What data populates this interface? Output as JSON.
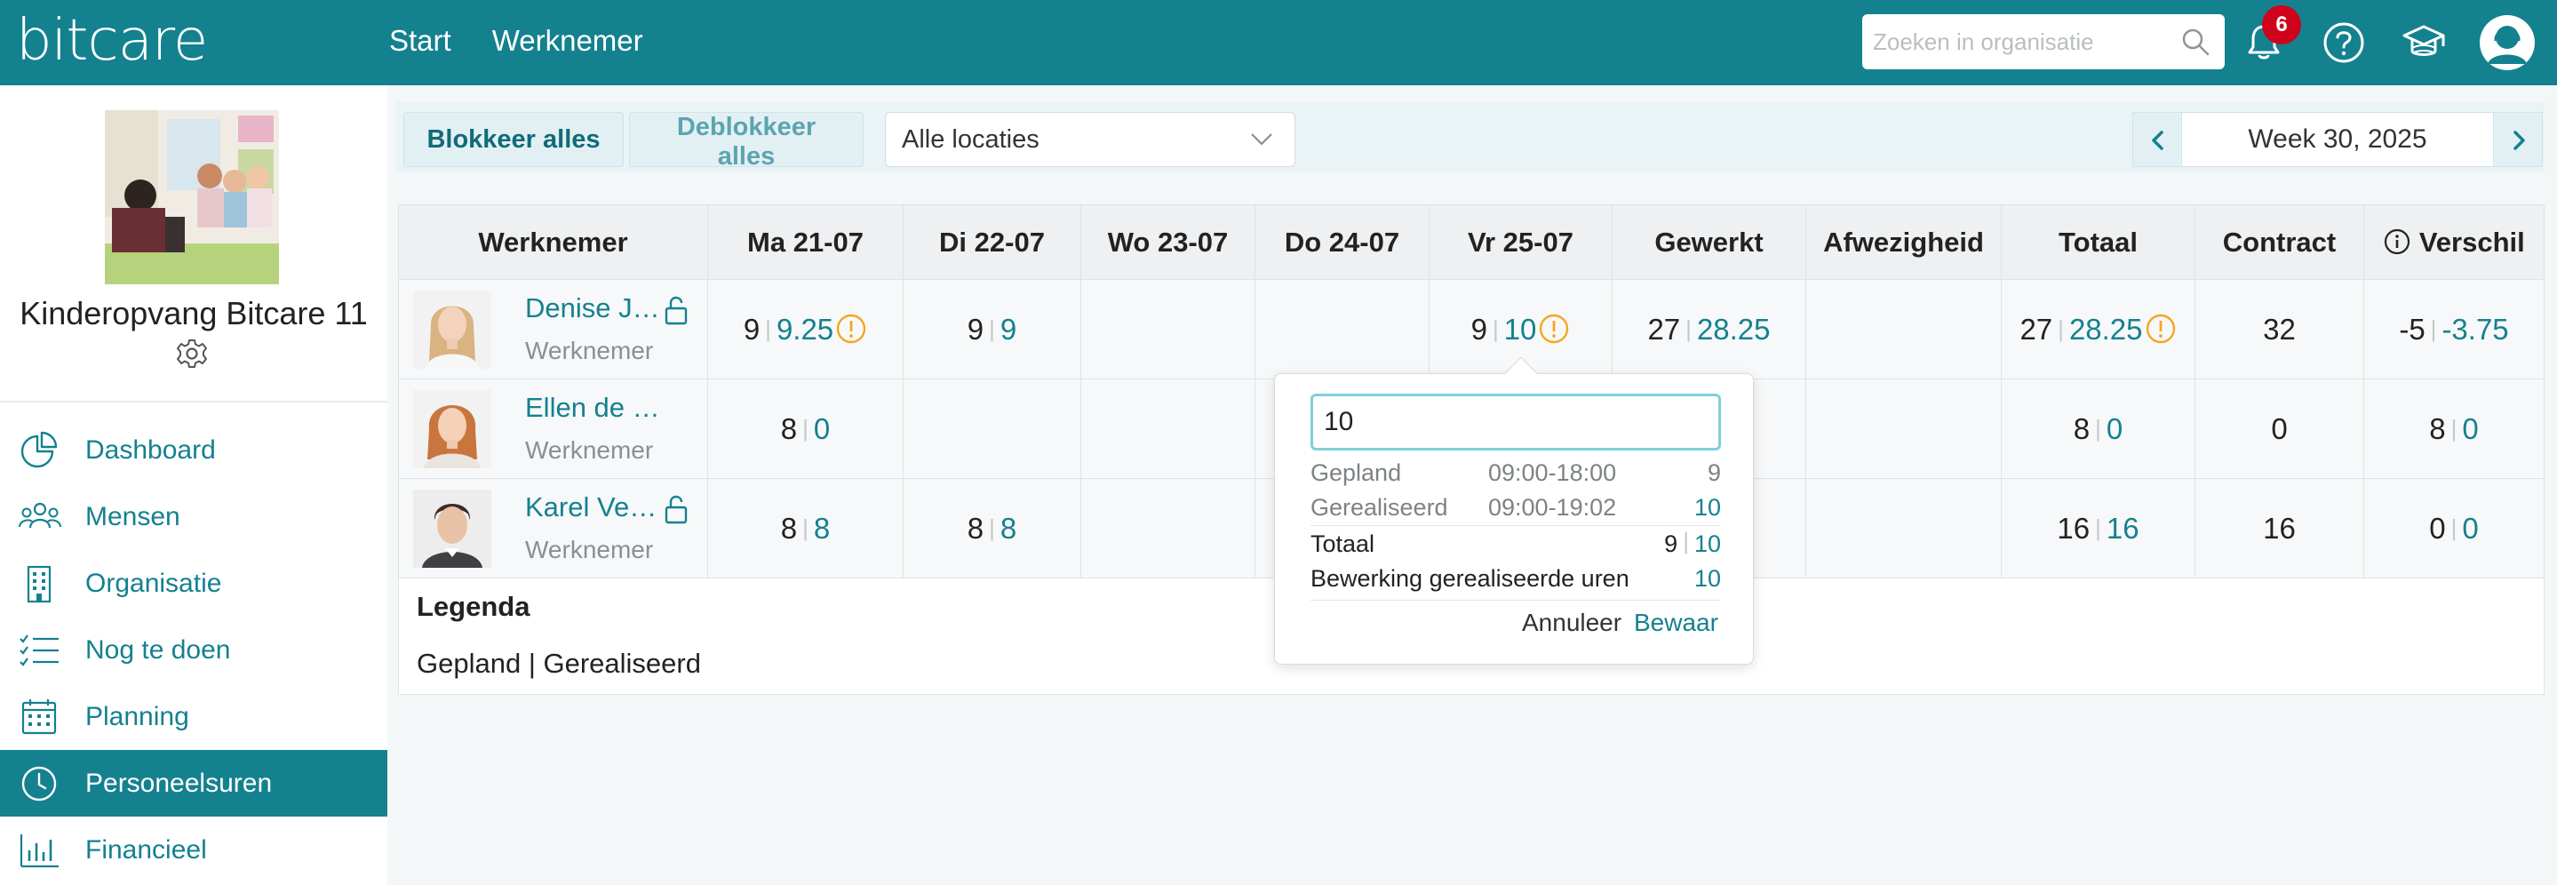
{
  "topbar": {
    "logo": "bitcare",
    "nav": [
      "Start",
      "Werknemer"
    ],
    "search_placeholder": "Zoeken in organisatie",
    "notification_count": "6",
    "accent": "#14818f",
    "badge_color": "#d0021b",
    "icons": [
      "search-icon",
      "bell-icon",
      "help-icon",
      "graduation-cap-icon",
      "user-avatar-icon"
    ]
  },
  "sidebar": {
    "org_name": "Kinderopvang Bitcare 11",
    "menu": [
      {
        "label": "Dashboard",
        "icon": "pie-chart-icon",
        "active": false
      },
      {
        "label": "Mensen",
        "icon": "people-icon",
        "active": false
      },
      {
        "label": "Organisatie",
        "icon": "building-icon",
        "active": false
      },
      {
        "label": "Nog te doen",
        "icon": "checklist-icon",
        "active": false
      },
      {
        "label": "Planning",
        "icon": "calendar-icon",
        "active": false
      },
      {
        "label": "Personeelsuren",
        "icon": "clock-icon",
        "active": true
      },
      {
        "label": "Financieel",
        "icon": "bar-chart-icon",
        "active": false
      }
    ]
  },
  "toolbar": {
    "block_all": "Blokkeer alles",
    "unblock_all": "Deblokkeer alles",
    "location": "Alle locaties",
    "week": "Week 30, 2025"
  },
  "table": {
    "headers": [
      "Werknemer",
      "Ma 21-07",
      "Di 22-07",
      "Wo 23-07",
      "Do 24-07",
      "Vr 25-07",
      "Gewerkt",
      "Afwezigheid",
      "Totaal",
      "Contract",
      "Verschil"
    ],
    "rows": [
      {
        "name": "Denise J…",
        "role": "Werknemer",
        "locked": true,
        "days": [
          {
            "p": "9",
            "r": "9.25",
            "warn": true
          },
          {
            "p": "9",
            "r": "9",
            "warn": false
          },
          null,
          null,
          {
            "p": "9",
            "r": "10",
            "warn": true
          }
        ],
        "gewerkt": {
          "p": "27",
          "r": "28.25",
          "warn": false
        },
        "totaal": {
          "p": "27",
          "r": "28.25",
          "warn": true
        },
        "contract": "32",
        "verschil": {
          "p": "-5",
          "r": "-3.75",
          "warn": false
        }
      },
      {
        "name": "Ellen de …",
        "role": "Werknemer",
        "locked": false,
        "days": [
          {
            "p": "8",
            "r": "0",
            "warn": false
          },
          null,
          null,
          null,
          null
        ],
        "gewerkt": null,
        "totaal": {
          "p": "8",
          "r": "0",
          "warn": false
        },
        "contract": "0",
        "verschil": {
          "p": "8",
          "r": "0",
          "warn": false
        }
      },
      {
        "name": "Karel Ve…",
        "role": "Werknemer",
        "locked": true,
        "days": [
          {
            "p": "8",
            "r": "8",
            "warn": false
          },
          {
            "p": "8",
            "r": "8",
            "warn": false
          },
          null,
          null,
          null
        ],
        "gewerkt": null,
        "totaal": {
          "p": "16",
          "r": "16",
          "warn": false
        },
        "contract": "16",
        "verschil": {
          "p": "0",
          "r": "0",
          "warn": false
        }
      }
    ]
  },
  "legend": {
    "title": "Legenda",
    "text": "Gepland | Gerealiseerd"
  },
  "popover": {
    "input_value": "10",
    "gepland_label": "Gepland",
    "gepland_time": "09:00-18:00",
    "gepland_value": "9",
    "gerealiseerd_label": "Gerealiseerd",
    "gerealiseerd_time": "09:00-19:02",
    "gerealiseerd_value": "10",
    "totaal_label": "Totaal",
    "totaal_p": "9",
    "totaal_r": "10",
    "bewerking_label": "Bewerking gerealiseerde uren",
    "bewerking_value": "10",
    "cancel": "Annuleer",
    "save": "Bewaar"
  }
}
